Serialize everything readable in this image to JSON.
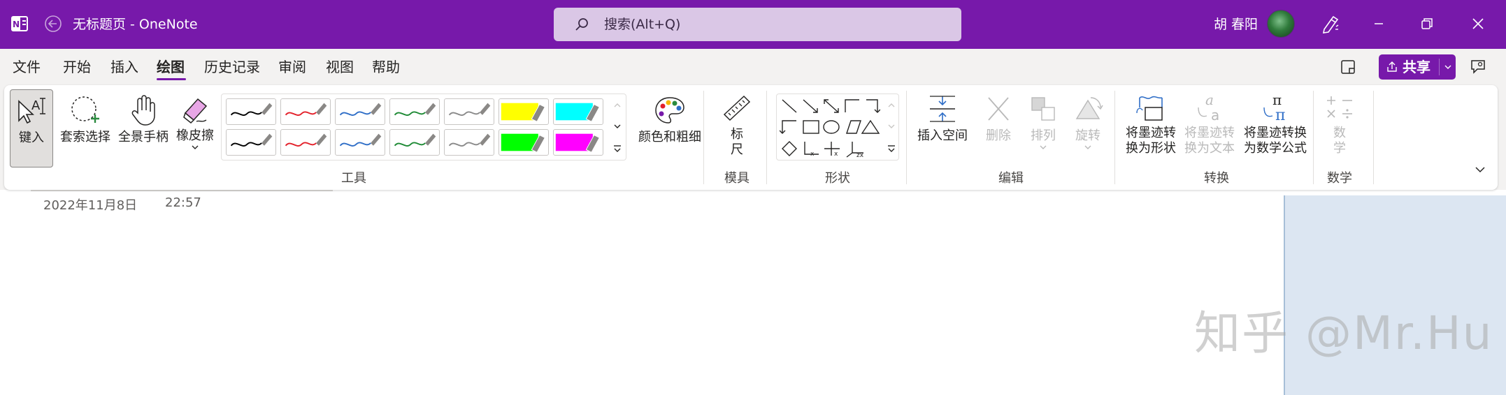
{
  "window": {
    "title": "无标题页  -  OneNote",
    "search_placeholder": "搜索(Alt+Q)",
    "user_name": "胡 春阳"
  },
  "menu": {
    "items": [
      "文件",
      "开始",
      "插入",
      "绘图",
      "历史记录",
      "审阅",
      "视图",
      "帮助"
    ],
    "active": "绘图",
    "share_label": "共享"
  },
  "ribbon": {
    "tools": {
      "type_label": "键入",
      "lasso_label": "套索选择",
      "pan_label": "全景手柄",
      "eraser_label": "橡皮擦",
      "color_label": "颜色和粗细",
      "group_label": "工具"
    },
    "stencils": {
      "ruler_label_1": "标",
      "ruler_label_2": "尺",
      "group_label": "模具"
    },
    "shapes": {
      "group_label": "形状"
    },
    "edit": {
      "insert_space_label": "插入空间",
      "delete_label": "删除",
      "arrange_label": "排列",
      "rotate_label": "旋转",
      "group_label": "编辑"
    },
    "convert": {
      "ink_to_shape_1": "将墨迹转",
      "ink_to_shape_2": "换为形状",
      "ink_to_text_1": "将墨迹转",
      "ink_to_text_2": "换为文本",
      "ink_to_math_1": "将墨迹转换",
      "ink_to_math_2": "为数学公式",
      "group_label": "转换"
    },
    "math": {
      "math_label_1": "数",
      "math_label_2": "学",
      "group_label": "数学"
    },
    "pens": [
      {
        "color": "#000000",
        "type": "pen"
      },
      {
        "color": "#e3202a",
        "type": "pen"
      },
      {
        "color": "#2f6ec7",
        "type": "pen"
      },
      {
        "color": "#1e8a35",
        "type": "pen"
      },
      {
        "color": "#8a8a8a",
        "type": "pen"
      },
      {
        "color": "#ffff00",
        "type": "highlighter"
      },
      {
        "color": "#00ffff",
        "type": "highlighter"
      },
      {
        "color": "#000000",
        "type": "pen"
      },
      {
        "color": "#e3202a",
        "type": "pen"
      },
      {
        "color": "#2f6ec7",
        "type": "pen"
      },
      {
        "color": "#1e8a35",
        "type": "pen"
      },
      {
        "color": "#8a8a8a",
        "type": "pen"
      },
      {
        "color": "#00ff00",
        "type": "highlighter"
      },
      {
        "color": "#ff00ff",
        "type": "highlighter"
      }
    ]
  },
  "page": {
    "date": "2022年11月8日",
    "time": "22:57"
  },
  "watermark": "知乎 @Mr.Hu",
  "colors": {
    "brand": "#7719aa",
    "ribbon_bg": "#f3f2f1",
    "search_bg": "#dac7e6"
  }
}
